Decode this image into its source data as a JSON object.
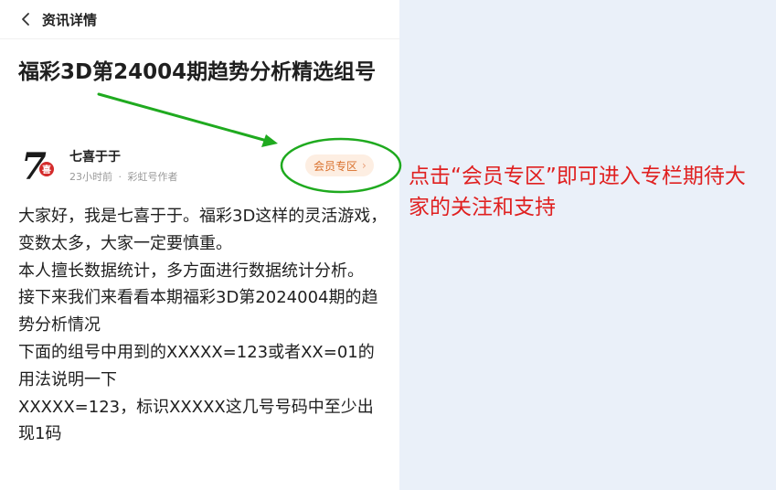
{
  "header": {
    "title": "资讯详情",
    "back_icon": "chevron-left-icon"
  },
  "article": {
    "title": "福彩3D第24004期趋势分析精选组号",
    "author": {
      "name": "七喜于于",
      "time": "23小时前",
      "separator": "·",
      "role": "彩虹号作者",
      "avatar_text": "7",
      "avatar_badge": "喜"
    },
    "member_button": {
      "label": "会员专区",
      "chevron": "›"
    },
    "paragraphs": [
      "大家好，我是七喜于于。福彩3D这样的灵活游戏，变数太多，大家一定要慎重。",
      "本人擅长数据统计，多方面进行数据统计分析。",
      "接下来我们来看看本期福彩3D第2024004期的趋势分析情况",
      "下面的组号中用到的XXXXX=123或者XX=01的用法说明一下",
      "XXXXX=123，标识XXXXX这几号号码中至少出现1码"
    ]
  },
  "annotation": {
    "text": "点击“会员专区”即可进入专栏期待大家的关注和支持",
    "color": "#e02020",
    "arrow_color": "#1faa1f"
  },
  "colors": {
    "page_background": "#eaf0f9",
    "member_button_bg": "#fdeee2",
    "member_button_text": "#d9702c"
  }
}
